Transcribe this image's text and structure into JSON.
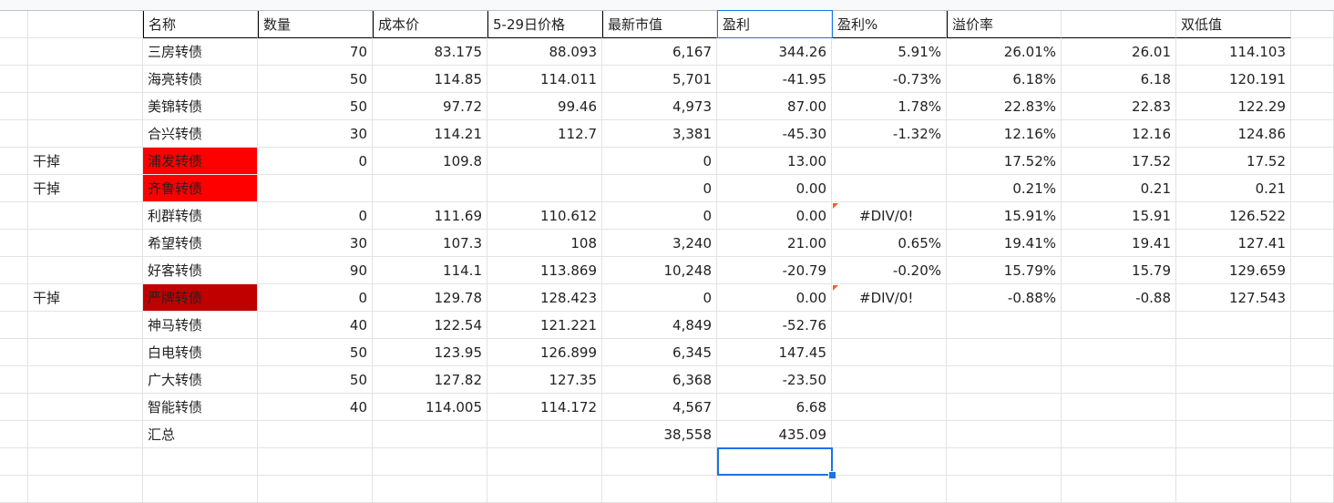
{
  "sheet": {
    "headers": [
      "名称",
      "数量",
      "成本价",
      "5-29日价格",
      "最新市值",
      "盈利",
      "盈利%",
      "溢价率",
      "",
      "双低值"
    ],
    "rows": [
      {
        "note": "",
        "name": "三房转债",
        "qty": "70",
        "cost": "83.175",
        "price": "88.093",
        "value": "6,167",
        "profit": "344.26",
        "pct": "5.91%",
        "premium": "26.01%",
        "k": "26.01",
        "dual": "114.103",
        "hl": "",
        "flag": false
      },
      {
        "note": "",
        "name": "海亮转债",
        "qty": "50",
        "cost": "114.85",
        "price": "114.011",
        "value": "5,701",
        "profit": "-41.95",
        "pct": "-0.73%",
        "premium": "6.18%",
        "k": "6.18",
        "dual": "120.191",
        "hl": "",
        "flag": false
      },
      {
        "note": "",
        "name": "美锦转债",
        "qty": "50",
        "cost": "97.72",
        "price": "99.46",
        "value": "4,973",
        "profit": "87.00",
        "pct": "1.78%",
        "premium": "22.83%",
        "k": "22.83",
        "dual": "122.29",
        "hl": "",
        "flag": false
      },
      {
        "note": "",
        "name": "合兴转债",
        "qty": "30",
        "cost": "114.21",
        "price": "112.7",
        "value": "3,381",
        "profit": "-45.30",
        "pct": "-1.32%",
        "premium": "12.16%",
        "k": "12.16",
        "dual": "124.86",
        "hl": "",
        "flag": false
      },
      {
        "note": "干掉",
        "name": "浦发转债",
        "qty": "0",
        "cost": "109.8",
        "price": "",
        "value": "0",
        "profit": "13.00",
        "pct": "",
        "premium": "17.52%",
        "k": "17.52",
        "dual": "17.52",
        "hl": "red",
        "flag": false
      },
      {
        "note": "干掉",
        "name": "齐鲁转债",
        "qty": "",
        "cost": "",
        "price": "",
        "value": "0",
        "profit": "0.00",
        "pct": "",
        "premium": "0.21%",
        "k": "0.21",
        "dual": "0.21",
        "hl": "red",
        "flag": false
      },
      {
        "note": "",
        "name": "利群转债",
        "qty": "0",
        "cost": "111.69",
        "price": "110.612",
        "value": "0",
        "profit": "0.00",
        "pct": "#DIV/0!",
        "premium": "15.91%",
        "k": "15.91",
        "dual": "126.522",
        "hl": "",
        "flag": true
      },
      {
        "note": "",
        "name": "希望转债",
        "qty": "30",
        "cost": "107.3",
        "price": "108",
        "value": "3,240",
        "profit": "21.00",
        "pct": "0.65%",
        "premium": "19.41%",
        "k": "19.41",
        "dual": "127.41",
        "hl": "",
        "flag": false
      },
      {
        "note": "",
        "name": "好客转债",
        "qty": "90",
        "cost": "114.1",
        "price": "113.869",
        "value": "10,248",
        "profit": "-20.79",
        "pct": "-0.20%",
        "premium": "15.79%",
        "k": "15.79",
        "dual": "129.659",
        "hl": "",
        "flag": false
      },
      {
        "note": "干掉",
        "name": "严牌转债",
        "qty": "0",
        "cost": "129.78",
        "price": "128.423",
        "value": "0",
        "profit": "0.00",
        "pct": "#DIV/0!",
        "premium": "-0.88%",
        "k": "-0.88",
        "dual": "127.543",
        "hl": "dred",
        "flag": true
      },
      {
        "note": "",
        "name": "神马转债",
        "qty": "40",
        "cost": "122.54",
        "price": "121.221",
        "value": "4,849",
        "profit": "-52.76",
        "pct": "",
        "premium": "",
        "k": "",
        "dual": "",
        "hl": "",
        "flag": false
      },
      {
        "note": "",
        "name": "白电转债",
        "qty": "50",
        "cost": "123.95",
        "price": "126.899",
        "value": "6,345",
        "profit": "147.45",
        "pct": "",
        "premium": "",
        "k": "",
        "dual": "",
        "hl": "",
        "flag": false
      },
      {
        "note": "",
        "name": "广大转债",
        "qty": "50",
        "cost": "127.82",
        "price": "127.35",
        "value": "6,368",
        "profit": "-23.50",
        "pct": "",
        "premium": "",
        "k": "",
        "dual": "",
        "hl": "",
        "flag": false
      },
      {
        "note": "",
        "name": "智能转债",
        "qty": "40",
        "cost": "114.005",
        "price": "114.172",
        "value": "4,567",
        "profit": "6.68",
        "pct": "",
        "premium": "",
        "k": "",
        "dual": "",
        "hl": "",
        "flag": false
      },
      {
        "note": "",
        "name": "汇总",
        "qty": "",
        "cost": "",
        "price": "",
        "value": "38,558",
        "profit": "435.09",
        "pct": "",
        "premium": "",
        "k": "",
        "dual": "",
        "hl": "",
        "flag": false
      },
      {
        "note": "",
        "name": "",
        "qty": "",
        "cost": "",
        "price": "",
        "value": "",
        "profit": "",
        "pct": "",
        "premium": "",
        "k": "",
        "dual": "",
        "hl": "",
        "flag": false
      },
      {
        "note": "",
        "name": "",
        "qty": "",
        "cost": "",
        "price": "",
        "value": "",
        "profit": "",
        "pct": "",
        "premium": "",
        "k": "",
        "dual": "",
        "hl": "",
        "flag": false
      }
    ],
    "selected_cell": "盈利 column, row after 汇总",
    "colors": {
      "highlight_red": "#ff0000",
      "highlight_dark_red": "#c00000",
      "selection": "#1a73e8",
      "flag": "#ff5a1f"
    }
  }
}
